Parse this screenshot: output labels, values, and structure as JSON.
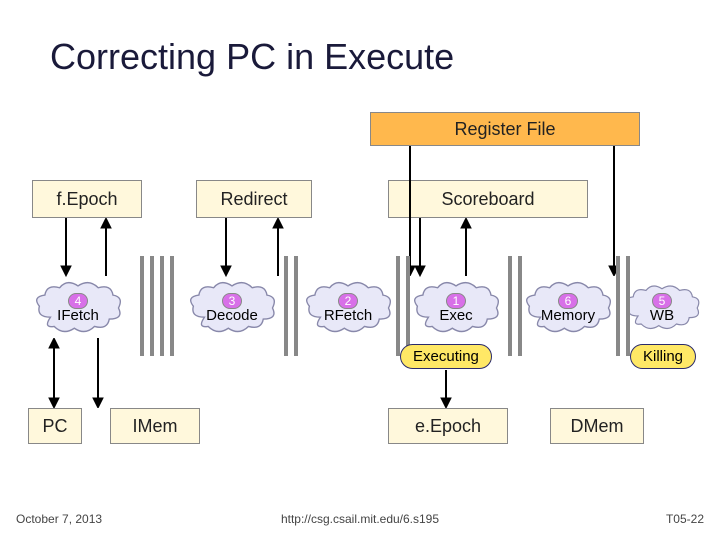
{
  "title": "Correcting PC in Execute",
  "boxes": {
    "register_file": "Register File",
    "fepoch": "f.Epoch",
    "redirect": "Redirect",
    "scoreboard": "Scoreboard",
    "pc": "PC",
    "imem": "IMem",
    "eepoch": "e.Epoch",
    "dmem": "DMem"
  },
  "stages": [
    {
      "num": "4",
      "label": "IFetch"
    },
    {
      "num": "3",
      "label": "Decode"
    },
    {
      "num": "2",
      "label": "RFetch"
    },
    {
      "num": "1",
      "label": "Exec"
    },
    {
      "num": "6",
      "label": "Memory"
    },
    {
      "num": "5",
      "label": "WB"
    }
  ],
  "pills": {
    "executing": "Executing",
    "killing": "Killing"
  },
  "footer": {
    "date": "October 7, 2013",
    "url": "http://csg.csail.mit.edu/6.s195",
    "page": "T05-22"
  }
}
